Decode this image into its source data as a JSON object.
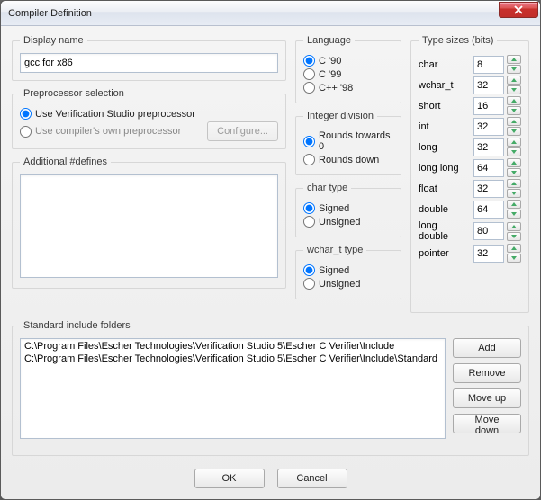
{
  "window": {
    "title": "Compiler Definition"
  },
  "display_name": {
    "legend": "Display name",
    "value": "gcc for x86"
  },
  "preprocessor": {
    "legend": "Preprocessor selection",
    "opt_studio": "Use Verification Studio preprocessor",
    "opt_own": "Use compiler's own preprocessor",
    "selected": "studio",
    "configure_btn": "Configure..."
  },
  "defines": {
    "legend": "Additional #defines",
    "value": ""
  },
  "language": {
    "legend": "Language",
    "c90": "C '90",
    "c99": "C '99",
    "cpp98": "C++ '98",
    "selected": "c90"
  },
  "int_div": {
    "legend": "Integer division",
    "towards0": "Rounds towards 0",
    "down": "Rounds down",
    "selected": "towards0"
  },
  "char_type": {
    "legend": "char type",
    "signed": "Signed",
    "unsigned": "Unsigned",
    "selected": "signed"
  },
  "wchar_type": {
    "legend": "wchar_t type",
    "signed": "Signed",
    "unsigned": "Unsigned",
    "selected": "signed"
  },
  "type_sizes": {
    "legend": "Type sizes (bits)",
    "items": {
      "char": {
        "label": "char",
        "value": "8"
      },
      "wchar_t": {
        "label": "wchar_t",
        "value": "32"
      },
      "short": {
        "label": "short",
        "value": "16"
      },
      "int": {
        "label": "int",
        "value": "32"
      },
      "long": {
        "label": "long",
        "value": "32"
      },
      "long_long": {
        "label": "long long",
        "value": "64"
      },
      "float": {
        "label": "float",
        "value": "32"
      },
      "double": {
        "label": "double",
        "value": "64"
      },
      "long_double": {
        "label": "long double",
        "value": "80"
      },
      "pointer": {
        "label": "pointer",
        "value": "32"
      }
    }
  },
  "include_folders": {
    "legend": "Standard include folders",
    "lines": [
      "C:\\Program Files\\Escher Technologies\\Verification Studio 5\\Escher C Verifier\\Include",
      "C:\\Program Files\\Escher Technologies\\Verification Studio 5\\Escher C Verifier\\Include\\Standard"
    ],
    "buttons": {
      "add": "Add",
      "remove": "Remove",
      "move_up": "Move up",
      "move_down": "Move down"
    }
  },
  "footer": {
    "ok": "OK",
    "cancel": "Cancel"
  }
}
